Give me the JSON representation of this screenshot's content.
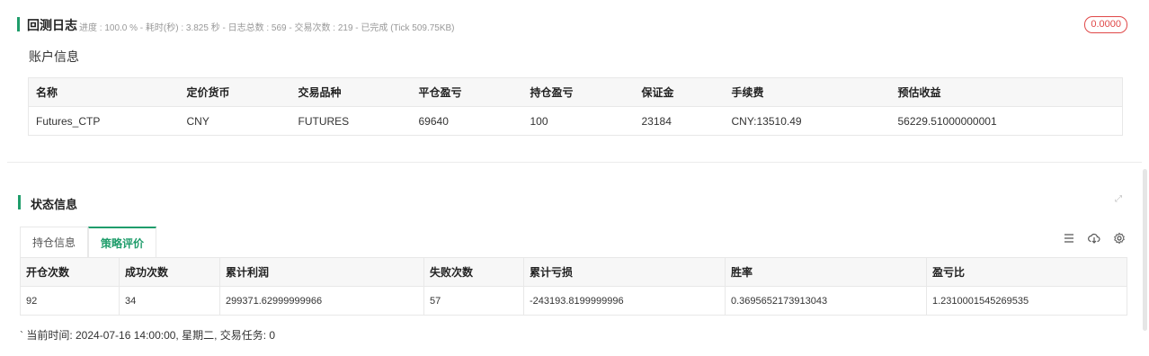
{
  "header": {
    "title": "回测日志",
    "meta": "进度 : 100.0 % - 耗时(秒) : 3.825 秒 - 日志总数 : 569 - 交易次数 : 219 - 已完成 (Tick 509.75KB)",
    "badge": "0.0000"
  },
  "account": {
    "section_label": "账户信息",
    "columns": [
      "名称",
      "定价货币",
      "交易品种",
      "平仓盈亏",
      "持仓盈亏",
      "保证金",
      "手续费",
      "预估收益"
    ],
    "rows": [
      [
        "Futures_CTP",
        "CNY",
        "FUTURES",
        "69640",
        "100",
        "23184",
        "CNY:13510.49",
        "56229.51000000001"
      ]
    ]
  },
  "status": {
    "title": "状态信息",
    "tabs": [
      {
        "label": "持仓信息",
        "active": false
      },
      {
        "label": "策略评价",
        "active": true
      }
    ],
    "tools": [
      "list-icon",
      "cloud-download-icon",
      "settings-icon"
    ],
    "columns": [
      "开仓次数",
      "成功次数",
      "累计利润",
      "失败次数",
      "累计亏损",
      "胜率",
      "盈亏比"
    ],
    "rows": [
      [
        "92",
        "34",
        "299371.62999999966",
        "57",
        "-243193.8199999996",
        "0.3695652173913043",
        "1.2310001545269535"
      ]
    ],
    "footer": "` 当前时间: 2024-07-16 14:00:00, 星期二, 交易任务: 0"
  },
  "colors": {
    "accent": "#1f9d6b",
    "badge": "#e04848"
  }
}
